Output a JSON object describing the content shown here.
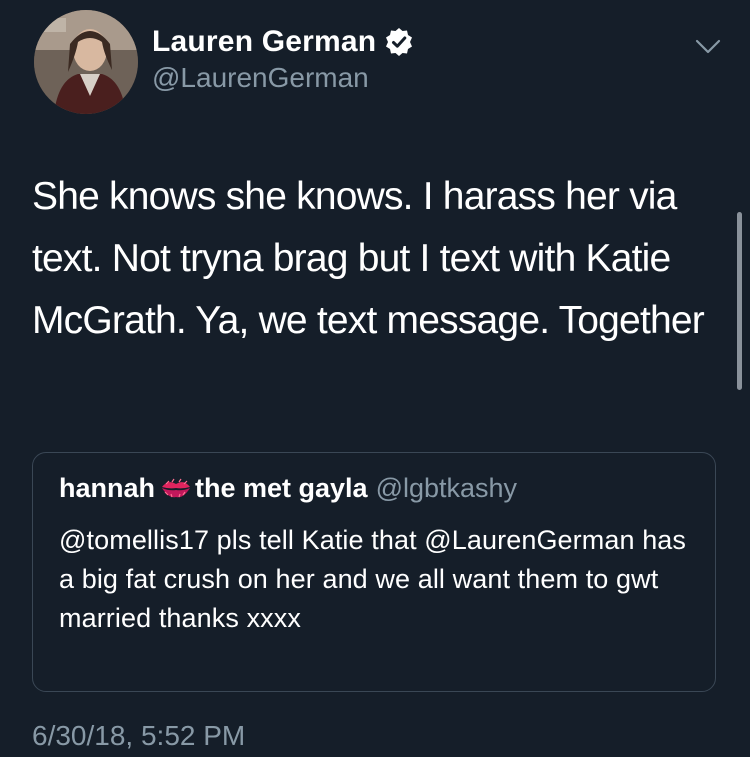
{
  "tweet": {
    "author": {
      "display_name": "Lauren German",
      "handle": "@LaurenGerman",
      "verified": true
    },
    "text": "She knows she knows. I harass her via text. Not tryna brag but I text with Katie McGrath. Ya, we text message. Together",
    "timestamp": "6/30/18, 5:52 PM",
    "menu_icon": "chevron-down-icon"
  },
  "quoted_tweet": {
    "display_name_part1": "hannah",
    "emoji": "kiss-mark-icon",
    "display_name_part2": "the met gayla",
    "handle": "@lgbtkashy",
    "text": "@tomellis17 pls tell Katie that @LaurenGerman has a big fat crush on her and we all want them to gwt married thanks xxxx"
  },
  "colors": {
    "background": "#151e29",
    "secondary_text": "#8899a6",
    "border": "#3a4755",
    "verified_badge": "#ffffff"
  }
}
